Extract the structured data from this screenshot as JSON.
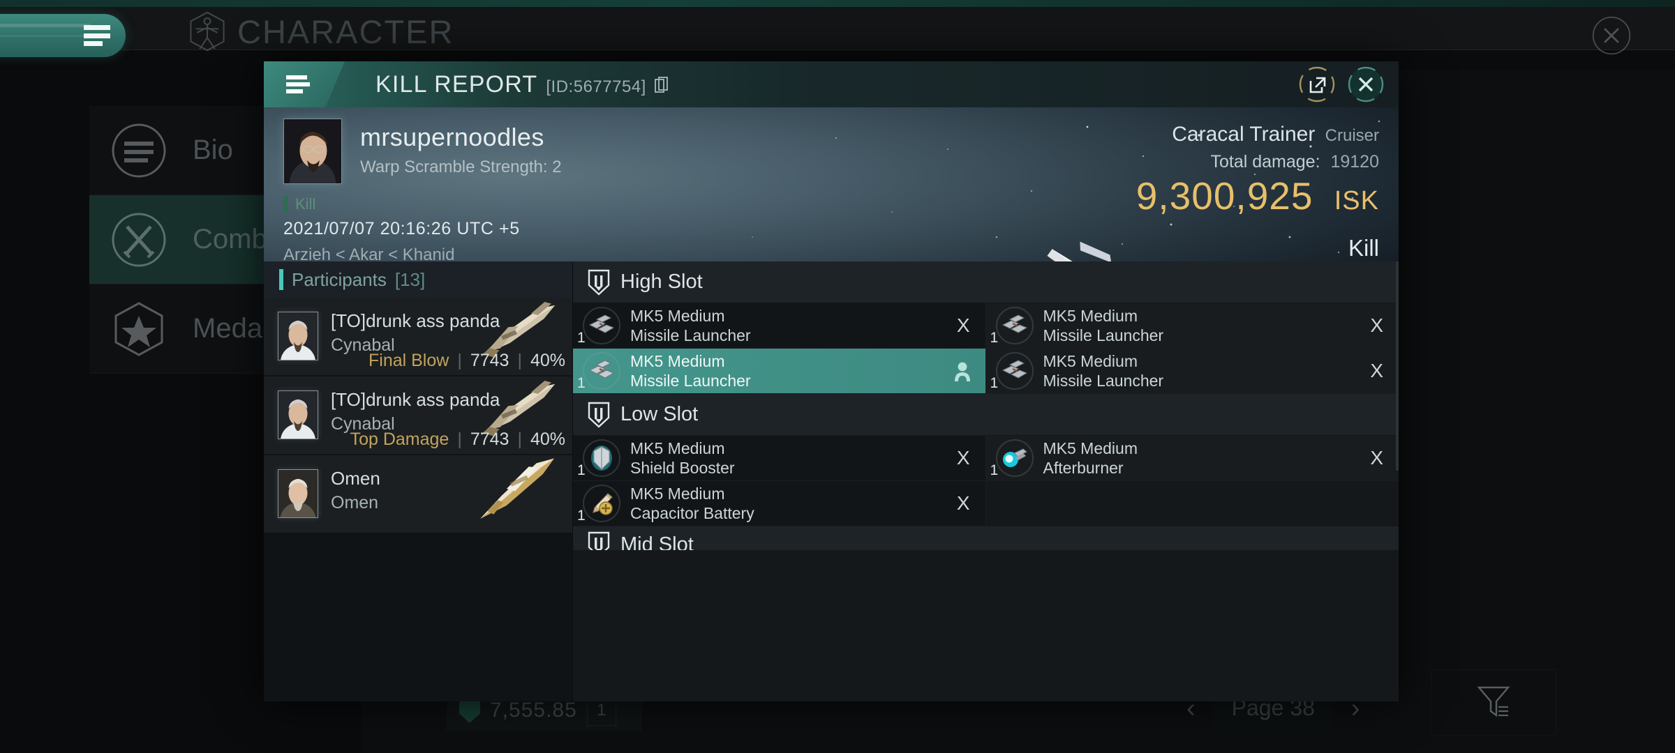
{
  "background": {
    "app_title": "CHARACTER",
    "menu_icon": "hamburger-icon",
    "vitruvian_icon": "vitruvian-man-icon",
    "close_icon": "close-icon",
    "nav_items": [
      {
        "label": "Bio",
        "icon": "list-lines-icon",
        "active": false
      },
      {
        "label": "Combat",
        "icon": "crossed-swords-icon",
        "active": true
      },
      {
        "label": "Medals",
        "icon": "star-badge-icon",
        "active": false
      }
    ],
    "ghost_row": {
      "value": "7,555.85",
      "qty": "1",
      "icon": "shield-icon"
    },
    "pager": {
      "prev": "‹",
      "label": "Page 38",
      "next": "›"
    },
    "filter_icon": "filter-funnel-icon"
  },
  "modal": {
    "header": {
      "menu_icon": "hamburger-icon",
      "title": "KILL REPORT",
      "id_label": "[ID:5677754]",
      "copy_icon": "copy-icon",
      "share_icon": "external-link-icon",
      "close_icon": "close-icon"
    },
    "hero": {
      "portrait_icon": "character-portrait",
      "pilot_name": "mrsupernoodles",
      "pilot_sub": "Warp Scramble Strength: 2",
      "kill_tag": "Kill",
      "timestamp": "2021/07/07 20:16:26 UTC +5",
      "location": "Arzieh < Akar < Khanid",
      "ship_name": "Caracal Trainer",
      "ship_class": "Cruiser",
      "damage_label": "Total damage:",
      "damage_value": "19120",
      "isk_value": "9,300,925",
      "isk_unit": "ISK",
      "result": "Kill",
      "ship_art": "caracal-cruiser-render"
    },
    "participants": {
      "title": "Participants",
      "count": "[13]",
      "rows": [
        {
          "name": "[TO]drunk ass panda",
          "ship": "Cynabal",
          "tag": "Final Blow",
          "damage": "7743",
          "percent": "40%",
          "ship_art": "cynabal-ship"
        },
        {
          "name": "[TO]drunk ass panda",
          "ship": "Cynabal",
          "tag": "Top Damage",
          "damage": "7743",
          "percent": "40%",
          "ship_art": "cynabal-ship"
        },
        {
          "name": "Omen",
          "ship": "Omen",
          "tag": "",
          "damage": "",
          "percent": "",
          "ship_art": "omen-ship"
        }
      ]
    },
    "fitting": {
      "sections": [
        {
          "title": "High Slot",
          "icon": "slot-shield-icon",
          "items": [
            {
              "name": "MK5 Medium Missile Launcher",
              "qty": "1",
              "action": "X",
              "selected": false,
              "icon": "missile-launcher-icon"
            },
            {
              "name": "MK5 Medium Missile Launcher",
              "qty": "1",
              "action": "X",
              "selected": false,
              "icon": "missile-launcher-icon"
            },
            {
              "name": "MK5 Medium Missile Launcher",
              "qty": "1",
              "action": "person",
              "selected": true,
              "icon": "missile-launcher-icon"
            },
            {
              "name": "MK5 Medium Missile Launcher",
              "qty": "1",
              "action": "X",
              "selected": false,
              "icon": "missile-launcher-icon"
            }
          ]
        },
        {
          "title": "Low Slot",
          "icon": "slot-shield-icon",
          "items": [
            {
              "name": "MK5 Medium Shield Booster",
              "qty": "1",
              "action": "X",
              "selected": false,
              "icon": "shield-booster-icon"
            },
            {
              "name": "MK5 Medium Afterburner",
              "qty": "1",
              "action": "X",
              "selected": false,
              "icon": "afterburner-icon"
            },
            {
              "name": "MK5 Medium Capacitor Battery",
              "qty": "1",
              "action": "X",
              "selected": false,
              "icon": "capacitor-battery-icon"
            },
            {
              "name": "",
              "qty": "",
              "action": "",
              "selected": false,
              "icon": ""
            }
          ]
        }
      ],
      "next_section_title": "Mid Slot",
      "next_section_icon": "slot-shield-icon"
    }
  },
  "colors": {
    "accent_teal": "#44968c",
    "accent_bright": "#49c8bd",
    "isk_gold": "#e8c06a",
    "tag_gold": "#c3a35d",
    "panel_dark": "#15181a"
  }
}
